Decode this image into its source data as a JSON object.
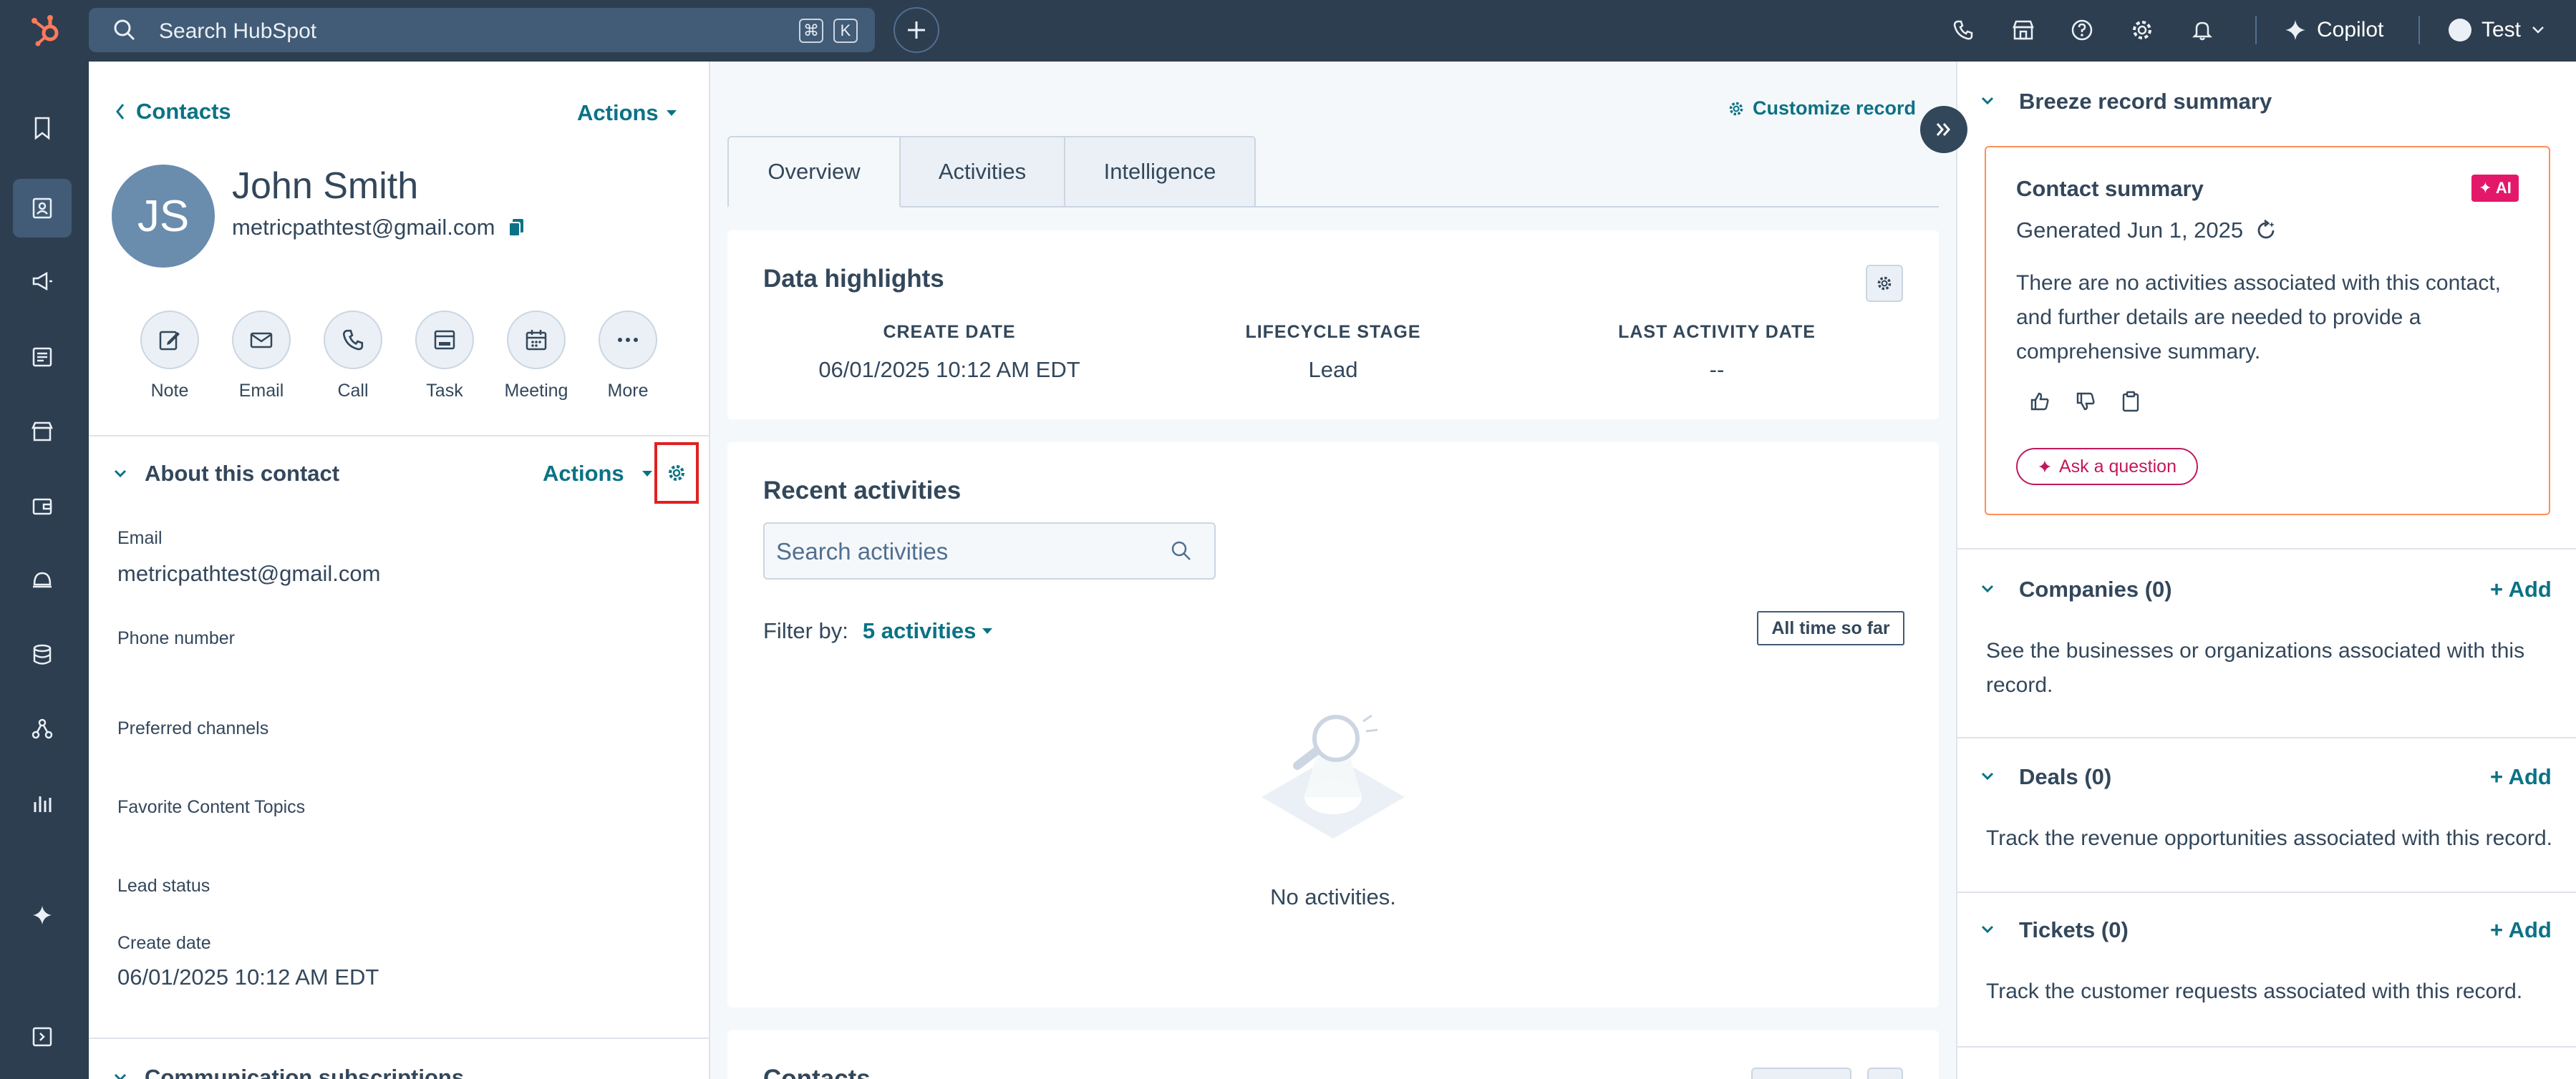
{
  "topbar": {
    "search_placeholder": "Search HubSpot",
    "shortcut_keys": [
      "⌘",
      "K"
    ],
    "copilot_label": "Copilot",
    "account_name": "Test"
  },
  "record": {
    "back_label": "Contacts",
    "actions_label": "Actions",
    "initials": "JS",
    "name": "John Smith",
    "email": "metricpathtest@gmail.com",
    "quick_actions": [
      {
        "label": "Note"
      },
      {
        "label": "Email"
      },
      {
        "label": "Call"
      },
      {
        "label": "Task"
      },
      {
        "label": "Meeting"
      },
      {
        "label": "More"
      }
    ]
  },
  "about": {
    "title": "About this contact",
    "actions_label": "Actions",
    "fields": [
      {
        "label": "Email",
        "value": "metricpathtest@gmail.com"
      },
      {
        "label": "Phone number",
        "value": ""
      },
      {
        "label": "Preferred channels",
        "value": ""
      },
      {
        "label": "Favorite Content Topics",
        "value": ""
      },
      {
        "label": "Lead status",
        "value": ""
      },
      {
        "label": "Create date",
        "value": "06/01/2025 10:12 AM EDT"
      }
    ],
    "next_section": "Communication subscriptions"
  },
  "middle": {
    "customize_label": "Customize record",
    "tabs": [
      {
        "label": "Overview",
        "active": true
      },
      {
        "label": "Activities",
        "active": false
      },
      {
        "label": "Intelligence",
        "active": false
      }
    ],
    "highlights": {
      "title": "Data highlights",
      "items": [
        {
          "header": "CREATE DATE",
          "value": "06/01/2025 10:12 AM EDT"
        },
        {
          "header": "LIFECYCLE STAGE",
          "value": "Lead"
        },
        {
          "header": "LAST ACTIVITY DATE",
          "value": "--"
        }
      ]
    },
    "recent": {
      "title": "Recent activities",
      "search_placeholder": "Search activities",
      "filter_label": "Filter by:",
      "filter_value": "5 activities",
      "time_button": "All time so far",
      "empty_text": "No activities."
    },
    "next_card_title": "Contacts"
  },
  "right": {
    "breeze_title": "Breeze record summary",
    "summary": {
      "title": "Contact summary",
      "ai_badge": "✦ AI",
      "generated": "Generated Jun 1, 2025",
      "text": "There are no activities associated with this contact, and further details are needed to provide a comprehensive summary.",
      "ask_label": "Ask a question"
    },
    "sections": [
      {
        "title": "Companies (0)",
        "add": "+ Add",
        "desc": "See the businesses or organizations associated with this record."
      },
      {
        "title": "Deals (0)",
        "add": "+ Add",
        "desc": "Track the revenue opportunities associated with this record."
      },
      {
        "title": "Tickets (0)",
        "add": "+ Add",
        "desc": "Track the customer requests associated with this record."
      }
    ]
  },
  "colors": {
    "nav_bg": "#2d3e50",
    "link": "#0b7285",
    "ai_pink": "#e3186b",
    "highlight_red": "#e02020"
  }
}
